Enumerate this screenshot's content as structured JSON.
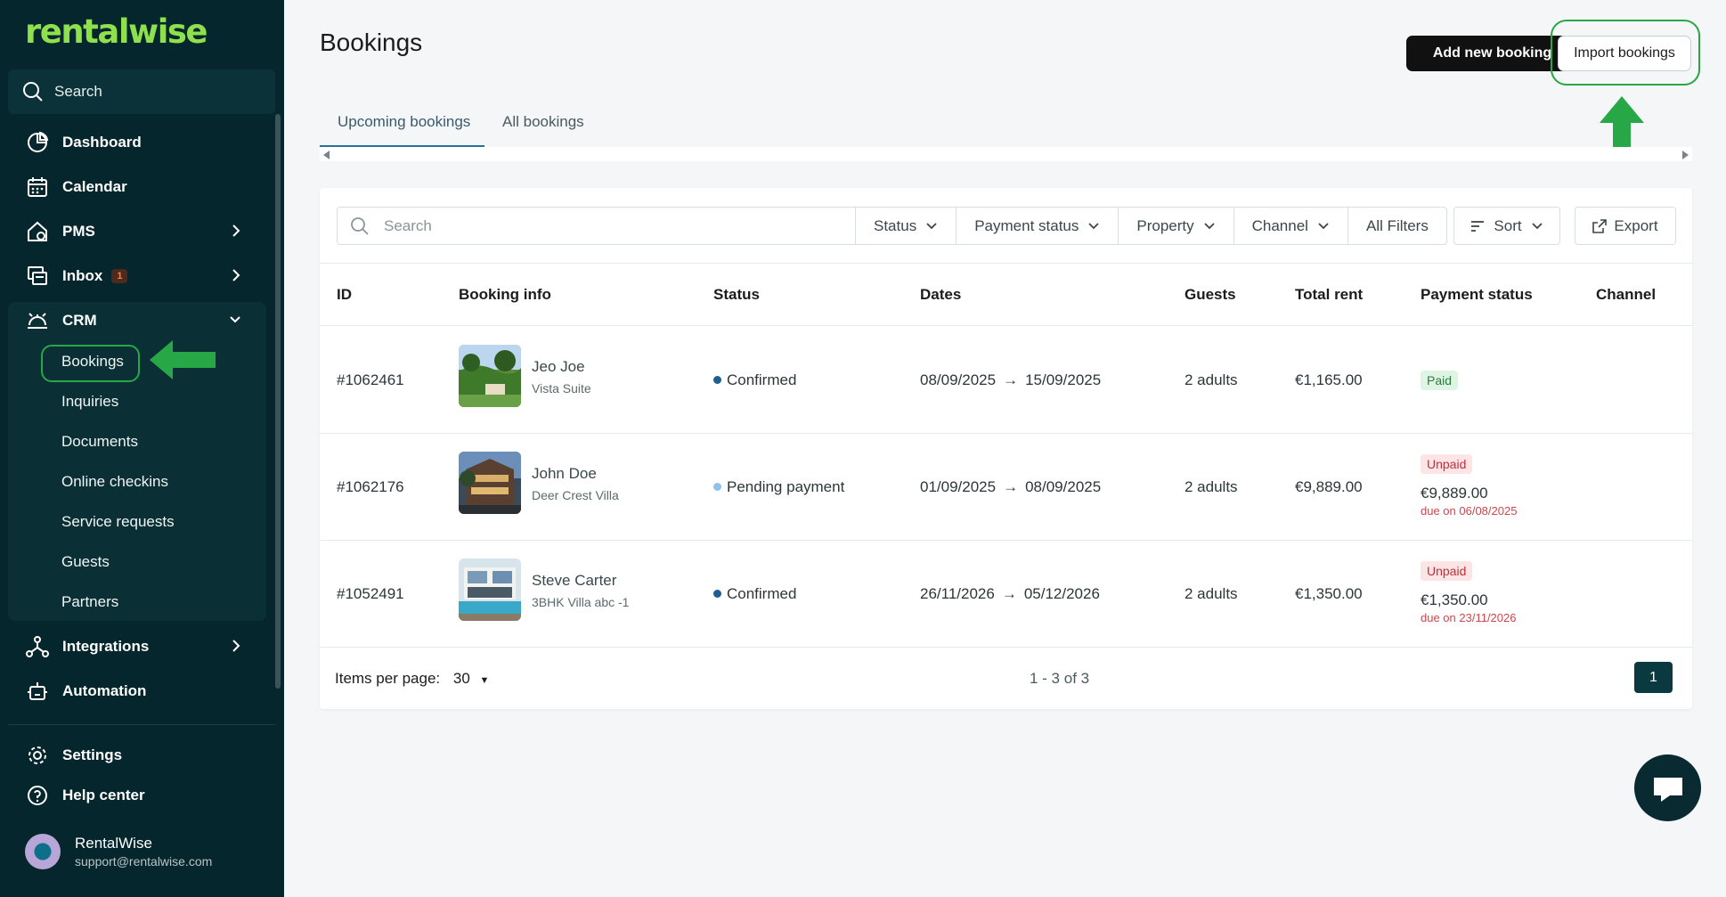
{
  "sidebar": {
    "logo": "rentalwise",
    "search_label": "Search",
    "items": [
      {
        "label": "Dashboard"
      },
      {
        "label": "Calendar"
      },
      {
        "label": "PMS"
      },
      {
        "label": "Inbox",
        "badge": "1"
      },
      {
        "label": "CRM"
      },
      {
        "label": "Integrations"
      },
      {
        "label": "Automation"
      },
      {
        "label": "Settings"
      },
      {
        "label": "Help center"
      }
    ],
    "crm_subitems": [
      "Bookings",
      "Inquiries",
      "Documents",
      "Online checkins",
      "Service requests",
      "Guests",
      "Partners"
    ],
    "user": {
      "name": "RentalWise",
      "email": "support@rentalwise.com"
    }
  },
  "header": {
    "title": "Bookings",
    "add_button": "Add new booking",
    "import_button": "Import bookings"
  },
  "tabs": [
    "Upcoming bookings",
    "All bookings"
  ],
  "filters": {
    "search_placeholder": "Search",
    "status": "Status",
    "payment_status": "Payment status",
    "property": "Property",
    "channel": "Channel",
    "all_filters": "All Filters",
    "sort": "Sort",
    "export": "Export"
  },
  "table": {
    "columns": [
      "ID",
      "Booking info",
      "Status",
      "Dates",
      "Guests",
      "Total rent",
      "Payment status",
      "Channel"
    ],
    "rows": [
      {
        "id": "#1062461",
        "guest": "Jeo Joe",
        "property": "Vista Suite",
        "status": "Confirmed",
        "start": "08/09/2025",
        "end": "15/09/2025",
        "guests": "2 adults",
        "total": "€1,165.00",
        "payment": "Paid",
        "amount": "",
        "due": ""
      },
      {
        "id": "#1062176",
        "guest": "John Doe",
        "property": "Deer Crest Villa",
        "status": "Pending payment",
        "start": "01/09/2025",
        "end": "08/09/2025",
        "guests": "2 adults",
        "total": "€9,889.00",
        "payment": "Unpaid",
        "amount": "€9,889.00",
        "due": "due on 06/08/2025"
      },
      {
        "id": "#1052491",
        "guest": "Steve Carter",
        "property": "3BHK Villa abc -1",
        "status": "Confirmed",
        "start": "26/11/2026",
        "end": "05/12/2026",
        "guests": "2 adults",
        "total": "€1,350.00",
        "payment": "Unpaid",
        "amount": "€1,350.00",
        "due": "due on 23/11/2026"
      }
    ]
  },
  "footer": {
    "items_per_page_label": "Items per page:",
    "items_per_page": "30",
    "range": "1 - 3 of 3",
    "page": "1"
  },
  "colors": {
    "sidebar_bg": "#04262c",
    "brand_green": "#8ee04c",
    "confirmed_dot": "#1d5f93",
    "pending_dot": "#8cc4ea",
    "annotation_green": "#27a745"
  }
}
